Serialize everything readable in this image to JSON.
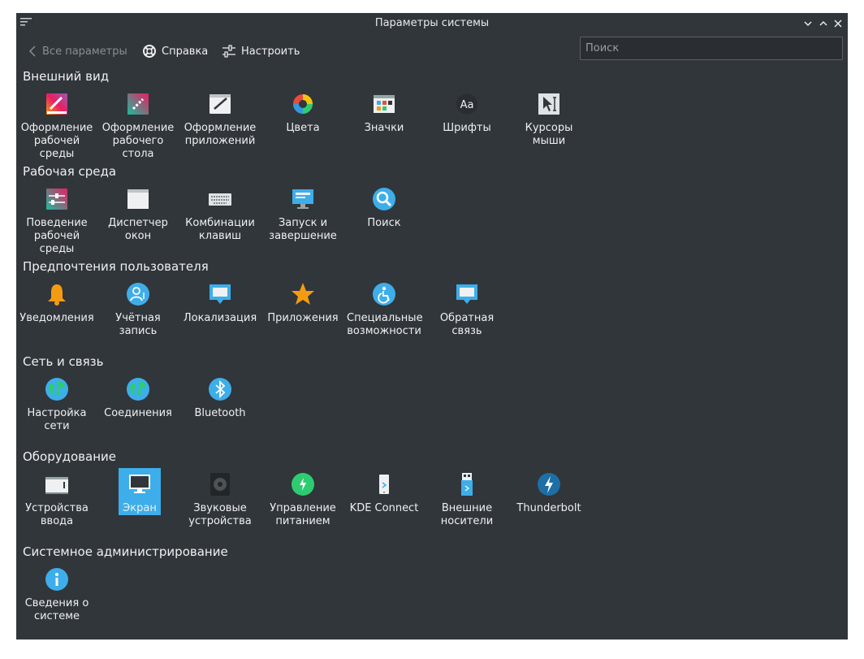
{
  "window": {
    "title": "Параметры системы"
  },
  "toolbar": {
    "back_label": "Все параметры",
    "help_label": "Справка",
    "configure_label": "Настроить",
    "search_placeholder": "Поиск"
  },
  "categories": [
    {
      "title": "Внешний вид",
      "items": [
        {
          "label": "Оформление рабочей среды",
          "icon": "workspace-theme-icon"
        },
        {
          "label": "Оформление рабочего стола",
          "icon": "desktop-theme-icon"
        },
        {
          "label": "Оформление приложений",
          "icon": "application-style-icon"
        },
        {
          "label": "Цвета",
          "icon": "colors-icon"
        },
        {
          "label": "Значки",
          "icon": "icons-icon"
        },
        {
          "label": "Шрифты",
          "icon": "fonts-icon"
        },
        {
          "label": "Курсоры мыши",
          "icon": "cursors-icon"
        }
      ]
    },
    {
      "title": "Рабочая среда",
      "items": [
        {
          "label": "Поведение рабочей среды",
          "icon": "workspace-behavior-icon"
        },
        {
          "label": "Диспетчер окон",
          "icon": "window-manager-icon"
        },
        {
          "label": "Комбинации клавиш",
          "icon": "keyboard-icon"
        },
        {
          "label": "Запуск и завершение",
          "icon": "startup-shutdown-icon"
        },
        {
          "label": "Поиск",
          "icon": "search-icon"
        }
      ]
    },
    {
      "title": "Предпочтения пользователя",
      "items": [
        {
          "label": "Уведомления",
          "icon": "bell-icon"
        },
        {
          "label": "Учётная запись",
          "icon": "user-account-icon"
        },
        {
          "label": "Локализация",
          "icon": "localization-icon"
        },
        {
          "label": "Приложения",
          "icon": "star-icon"
        },
        {
          "label": "Специальные возможности",
          "icon": "accessibility-icon"
        },
        {
          "label": "Обратная связь",
          "icon": "feedback-icon"
        }
      ]
    },
    {
      "title": "Сеть и связь",
      "items": [
        {
          "label": "Настройка сети",
          "icon": "globe-icon"
        },
        {
          "label": "Соединения",
          "icon": "globe-icon"
        },
        {
          "label": "Bluetooth",
          "icon": "bluetooth-icon"
        }
      ]
    },
    {
      "title": "Оборудование",
      "items": [
        {
          "label": "Устройства ввода",
          "icon": "input-devices-icon"
        },
        {
          "label": "Экран",
          "icon": "display-icon",
          "selected": true
        },
        {
          "label": "Звуковые устройства",
          "icon": "speaker-icon"
        },
        {
          "label": "Управление питанием",
          "icon": "power-icon"
        },
        {
          "label": "KDE Connect",
          "icon": "kde-connect-icon"
        },
        {
          "label": "Внешние носители",
          "icon": "usb-drive-icon"
        },
        {
          "label": "Thunderbolt",
          "icon": "thunderbolt-icon"
        }
      ]
    },
    {
      "title": "Системное администрирование",
      "items": [
        {
          "label": "Сведения о системе",
          "icon": "info-icon"
        }
      ]
    }
  ],
  "colors": {
    "window_bg": "#31363b",
    "selection": "#3daee9",
    "text": "#eff0f1"
  }
}
